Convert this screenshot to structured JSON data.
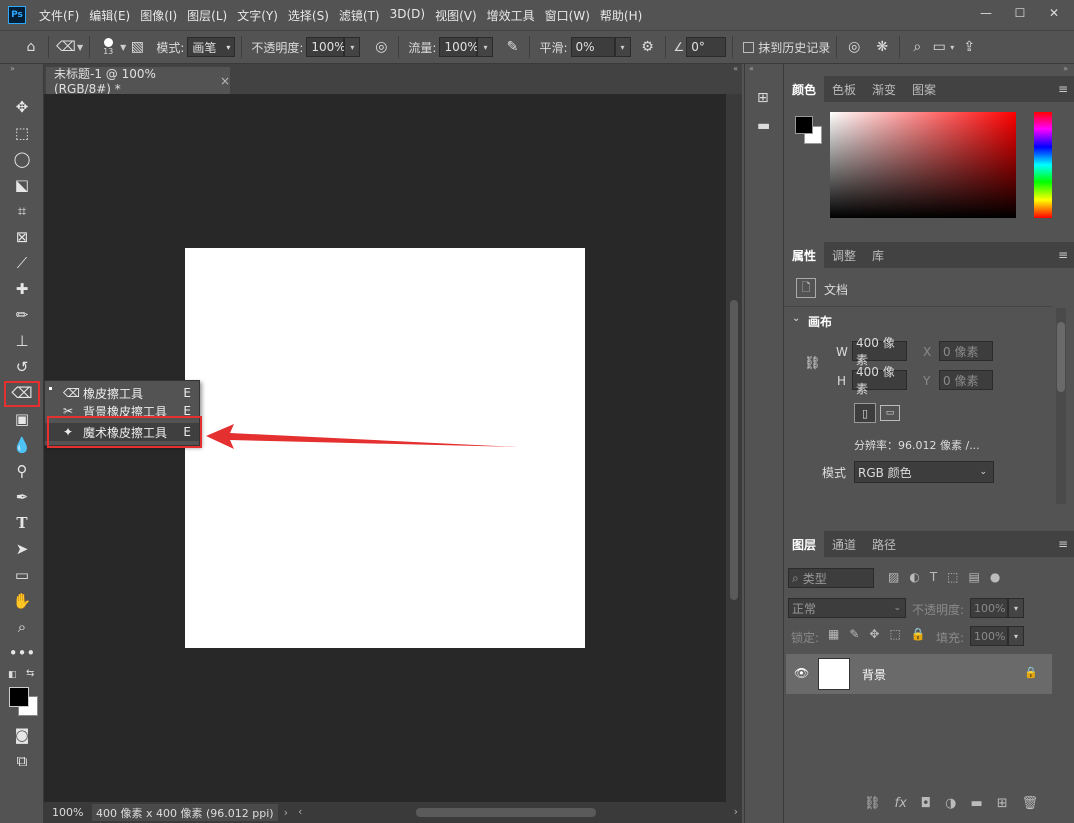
{
  "app": {
    "logo_text": "Ps"
  },
  "menu": [
    "文件(F)",
    "编辑(E)",
    "图像(I)",
    "图层(L)",
    "文字(Y)",
    "选择(S)",
    "滤镜(T)",
    "3D(D)",
    "视图(V)",
    "增效工具",
    "窗口(W)",
    "帮助(H)"
  ],
  "window": {
    "minimize": "—",
    "maximize": "☐",
    "close": "✕"
  },
  "options": {
    "brush_size": "13",
    "mode_label": "模式:",
    "mode_value": "画笔",
    "opacity_label": "不透明度:",
    "opacity_value": "100%",
    "flow_label": "流量:",
    "flow_value": "100%",
    "smooth_label": "平滑:",
    "smooth_value": "0%",
    "angle_value": "0°",
    "erase_history_label": "抹到历史记录"
  },
  "document": {
    "tab_title": "未标题-1 @ 100%(RGB/8#) *",
    "tab_close": "×",
    "zoom": "100%",
    "status": "400 像素 x 400 像素 (96.012 ppi)"
  },
  "flyout": {
    "items": [
      {
        "label": "橡皮擦工具",
        "key": "E"
      },
      {
        "label": "背景橡皮擦工具",
        "key": "E"
      },
      {
        "label": "魔术橡皮擦工具",
        "key": "E"
      }
    ]
  },
  "color_panel": {
    "tabs": [
      "颜色",
      "色板",
      "渐变",
      "图案"
    ]
  },
  "properties_panel": {
    "tabs": [
      "属性",
      "调整",
      "库"
    ],
    "doc_label": "文档",
    "section": "画布",
    "w_label": "W",
    "w_value": "400 像素",
    "h_label": "H",
    "h_value": "400 像素",
    "x_label": "X",
    "x_value": "0 像素",
    "y_label": "Y",
    "y_value": "0 像素",
    "resolution": "分辨率：96.012 像素 /...",
    "mode_label": "模式",
    "mode_value": "RGB 颜色"
  },
  "layers_panel": {
    "tabs": [
      "图层",
      "通道",
      "路径"
    ],
    "filter_label": "类型",
    "blend_mode": "正常",
    "opacity_label": "不透明度:",
    "opacity_value": "100%",
    "lock_label": "锁定:",
    "fill_label": "填充:",
    "fill_value": "100%",
    "layers": [
      {
        "name": "背景"
      }
    ]
  },
  "colors": {
    "accent_red": "#e53030",
    "foreground": "#000000",
    "background": "#ffffff"
  }
}
